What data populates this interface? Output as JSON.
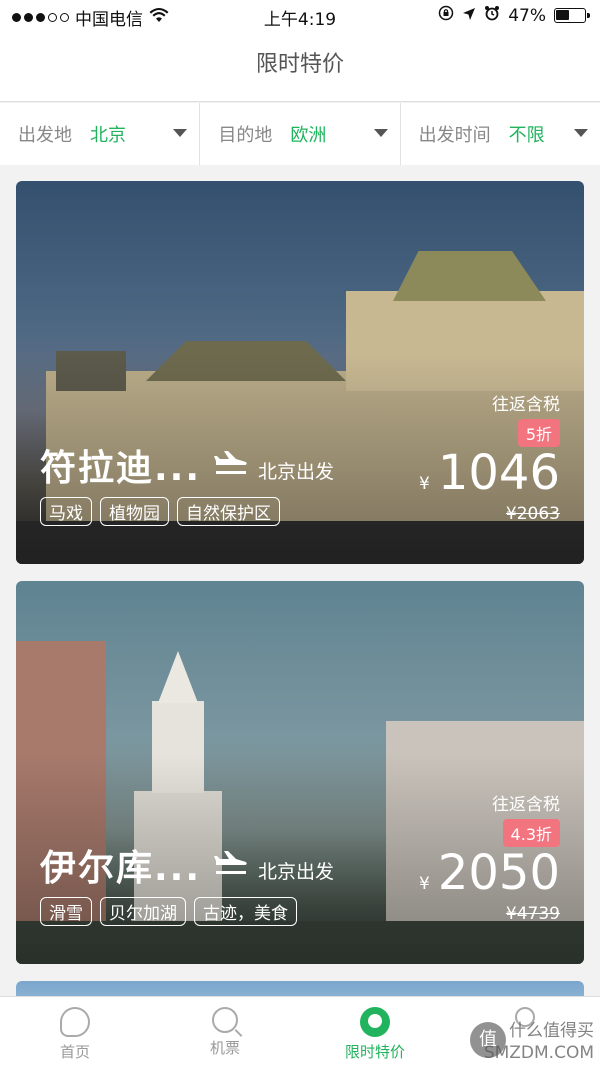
{
  "status_bar": {
    "carrier": "中国电信",
    "time": "上午4:19",
    "battery": "47%",
    "battery_level": 0.47
  },
  "navbar": {
    "title": "限时特价"
  },
  "filters": [
    {
      "label": "出发地",
      "value": "北京"
    },
    {
      "label": "目的地",
      "value": "欧洲"
    },
    {
      "label": "出发时间",
      "value": "不限"
    }
  ],
  "deals": [
    {
      "city": "符拉迪...",
      "departure": "北京出发",
      "tags": [
        "马戏",
        "植物园",
        "自然保护区"
      ],
      "roundtrip": "往返含税",
      "discount": "5折",
      "currency": "¥",
      "price": "1046",
      "original_price": "¥2063"
    },
    {
      "city": "伊尔库...",
      "departure": "北京出发",
      "tags": [
        "滑雪",
        "贝尔加湖",
        "古迹，美食"
      ],
      "roundtrip": "往返含税",
      "discount": "4.3折",
      "currency": "¥",
      "price": "2050",
      "original_price": "¥4739"
    }
  ],
  "tabbar": {
    "items": [
      {
        "label": "首页",
        "icon": "home-icon"
      },
      {
        "label": "机票",
        "icon": "search-icon"
      },
      {
        "label": "限时特价",
        "icon": "deal-icon",
        "active": true
      },
      {
        "label": "",
        "icon": "user-icon"
      }
    ]
  },
  "watermark": {
    "badge": "值",
    "line1": "什么值得买",
    "line2": "SMZDM.COM"
  },
  "colors": {
    "accent": "#22b35e",
    "discount": "#f2747f"
  }
}
